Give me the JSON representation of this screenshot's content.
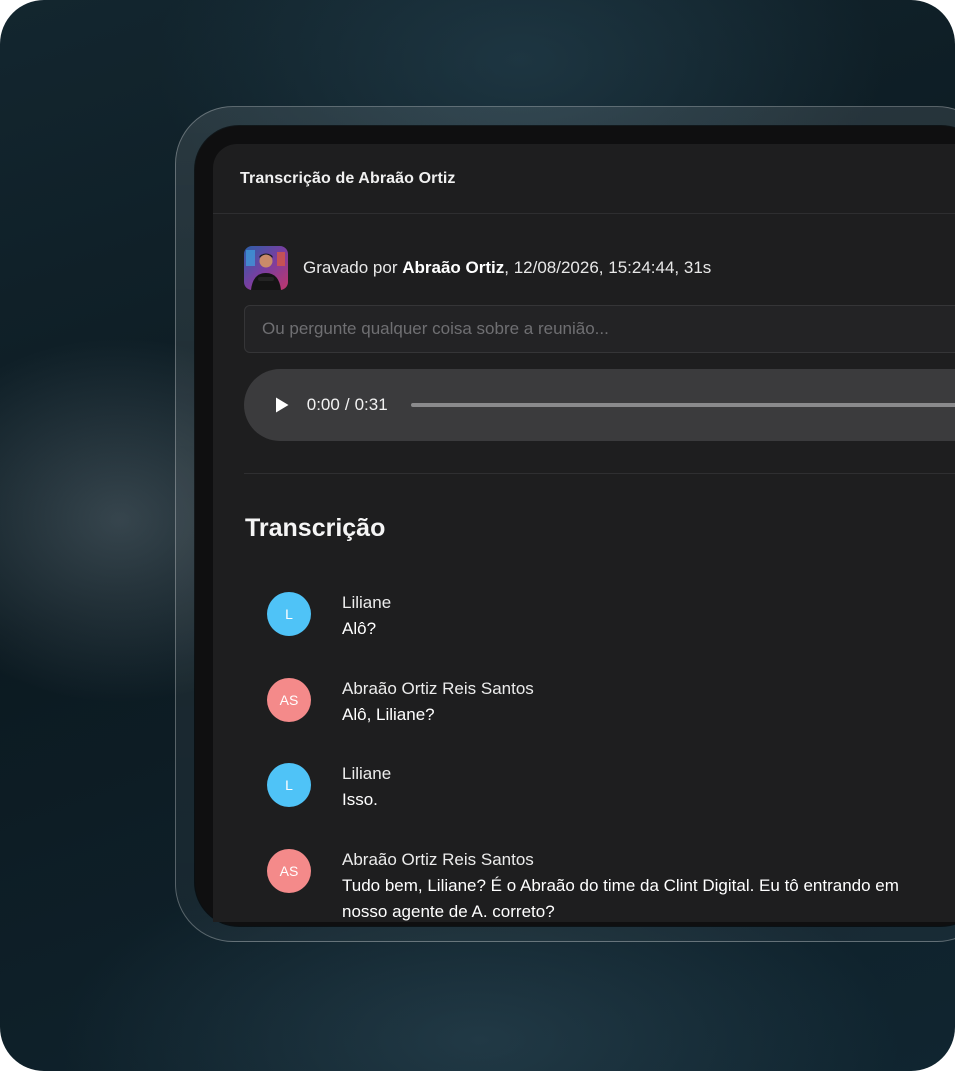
{
  "panel": {
    "title": "Transcrição de Abraão Ortiz"
  },
  "meta": {
    "prefix": "Gravado por",
    "recorder": "Abraão Ortiz",
    "details": ", 12/08/2026, 15:24:44, 31s"
  },
  "ask": {
    "placeholder": "Ou pergunte qualquer coisa sobre a reunião..."
  },
  "audio": {
    "current": "0:00",
    "separator": "/",
    "duration": "0:31",
    "progress": 0.0
  },
  "transcript": {
    "title": "Transcrição",
    "entries": [
      {
        "initials": "L",
        "speaker": "Liliane",
        "text": "Alô?",
        "color": "#4fc3f7"
      },
      {
        "initials": "AS",
        "speaker": "Abraão Ortiz Reis Santos",
        "text": "Alô, Liliane?",
        "color": "#f48a8a"
      },
      {
        "initials": "L",
        "speaker": "Liliane",
        "text": "Isso.",
        "color": "#4fc3f7"
      },
      {
        "initials": "AS",
        "speaker": "Abraão Ortiz Reis Santos",
        "text": "Tudo bem, Liliane? É o Abraão do time da Clint Digital. Eu tô entrando em",
        "text2": "nosso agente de A. correto?",
        "color": "#f48a8a"
      }
    ]
  },
  "colors": {
    "panel_bg": "#1e1e1f",
    "player_bg": "#3b3b3d",
    "speaker_l": "#4fc3f7",
    "speaker_as": "#f48a8a"
  }
}
